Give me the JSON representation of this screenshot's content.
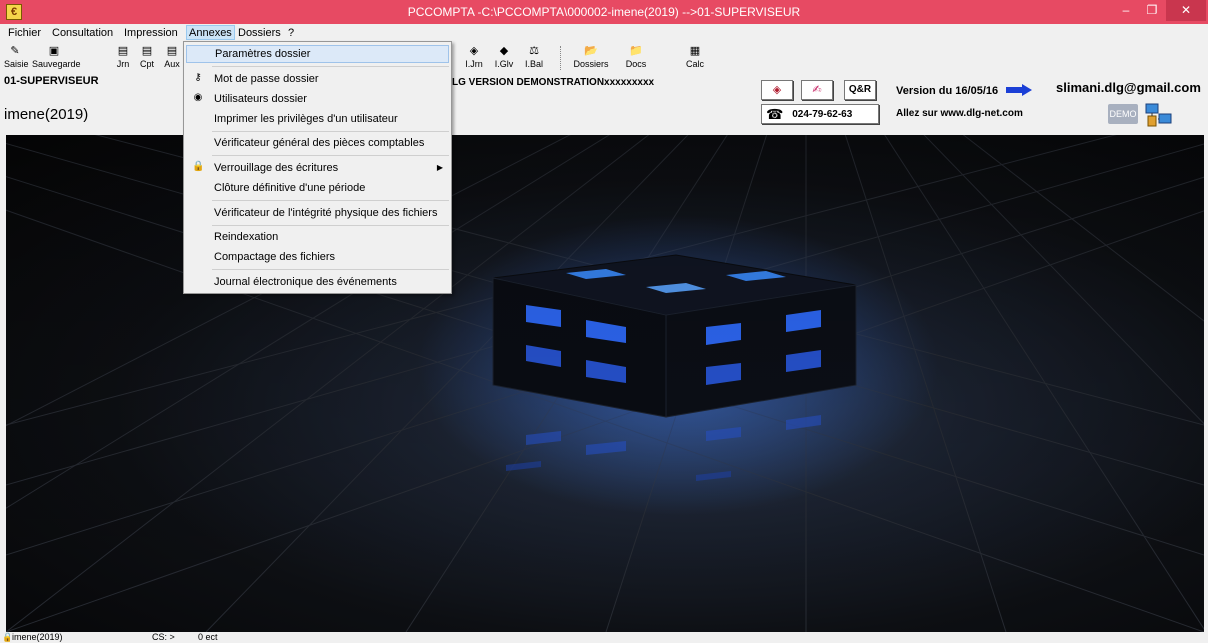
{
  "window": {
    "title": "PCCOMPTA -C:\\PCCOMPTA\\000002-imene(2019) -->01-SUPERVISEUR",
    "minimize": "–",
    "maximize": "❐",
    "close": "✕"
  },
  "menubar": [
    "Fichier",
    "Consultation",
    "Impression",
    "Annexes",
    "Dossiers",
    "?"
  ],
  "toolbar": {
    "saisie": "Saisie",
    "sauvegarde": "Sauvegarde",
    "jrn": "Jrn",
    "cpt": "Cpt",
    "aux": "Aux",
    "ijrn": "I.Jrn",
    "iglv": "I.Glv",
    "ibal": "I.Bal",
    "dossiers": "Dossiers",
    "docs": "Docs",
    "calc": "Calc"
  },
  "info": {
    "user": "01-SUPERVISEUR",
    "dossier": "imene(2019)",
    "demo_text": "LG VERSION DEMONSTRATIONxxxxxxxxx",
    "qr_label": "Q&R",
    "version": "Version du 16/05/16",
    "phone": "024-79-62-63",
    "site": "Allez sur  www.dlg-net.com",
    "email": "slimani.dlg@gmail.com",
    "demo_button": "DEMO"
  },
  "annexes_menu": {
    "items": [
      {
        "label": "Paramètres dossier",
        "icon": ""
      },
      {
        "label": "Mot de passe dossier",
        "icon": "key-icon"
      },
      {
        "label": "Utilisateurs dossier",
        "icon": "users-icon"
      },
      {
        "label": "Imprimer les privilèges  d'un utilisateur",
        "icon": ""
      },
      {
        "label": "Vérificateur général des pièces comptables",
        "icon": ""
      },
      {
        "label": "Verrouillage des écritures",
        "icon": "lock-icon"
      },
      {
        "label": "Clôture définitive d'une période",
        "icon": ""
      },
      {
        "label": "Vérificateur de l'intégrité physique des fichiers",
        "icon": ""
      },
      {
        "label": "Reindexation",
        "icon": ""
      },
      {
        "label": "Compactage des fichiers",
        "icon": ""
      },
      {
        "label": "Journal électronique des événements",
        "icon": ""
      }
    ]
  },
  "statusbar": {
    "dossier": "imene(2019)",
    "cs": "CS: >",
    "count": "0 ect"
  },
  "colors": {
    "titlebar": "#e74a63",
    "menu_highlight": "#dce9f8",
    "cube_glow": "#2f7cff"
  }
}
